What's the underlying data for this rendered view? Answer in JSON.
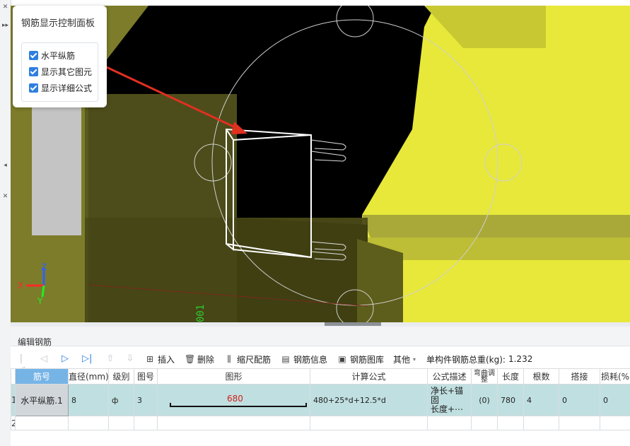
{
  "control_panel": {
    "title": "钢筋显示控制面板",
    "options": [
      {
        "label": "水平纵筋",
        "checked": true
      },
      {
        "label": "显示其它图元",
        "checked": true
      },
      {
        "label": "显示详细公式",
        "checked": true
      }
    ]
  },
  "axes": {
    "x": "X",
    "y": "Y",
    "z": "Z"
  },
  "viewport_label": "001",
  "edit_panel": {
    "title": "编辑钢筋",
    "toolbar": {
      "insert": "插入",
      "delete": "删除",
      "scale": "缩尺配筋",
      "info": "钢筋信息",
      "library": "钢筋图库",
      "other": "其他",
      "total_weight_label": "单构件钢筋总重(kg):",
      "total_weight_value": "1.232"
    },
    "columns": [
      "筋号",
      "直径(mm)",
      "级别",
      "图号",
      "图形",
      "计算公式",
      "公式描述",
      "弯曲调整",
      "长度",
      "根数",
      "搭接",
      "损耗(%"
    ],
    "rows": [
      {
        "row_no": "1",
        "name": "水平纵筋.1",
        "diameter": "8",
        "grade": "ф",
        "fig_no": "3",
        "shape_value": "680",
        "formula": "480+25*d+12.5*d",
        "desc_line1": "净长+锚固",
        "desc_line2": "长度+⋯",
        "bend": "(0)",
        "length": "780",
        "count": "4",
        "lap": "0",
        "loss": "0"
      },
      {
        "row_no": "2"
      }
    ]
  },
  "colors": {
    "accent": "#2d7fe0",
    "selected_row": "#c0dfe0",
    "header_selected": "#76b4e6",
    "wall": "#eaea3a"
  }
}
